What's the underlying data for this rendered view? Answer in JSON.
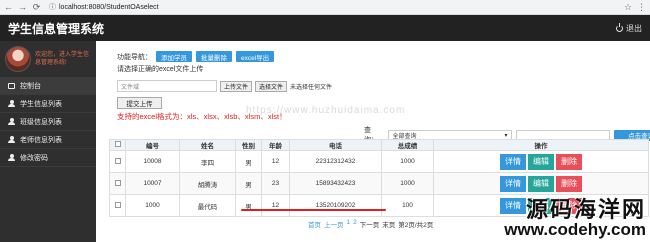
{
  "browser": {
    "url": "localhost:8080/StudentOAselect"
  },
  "header": {
    "title": "学生信息管理系统",
    "logout_label": "退出"
  },
  "sidebar": {
    "welcome": "欢迎您，进入学生信息管理系统!",
    "items": [
      {
        "label": "控制台",
        "icon": "monitor-icon"
      },
      {
        "label": "学生信息列表",
        "icon": "user-icon"
      },
      {
        "label": "班级信息列表",
        "icon": "user-icon"
      },
      {
        "label": "老师信息列表",
        "icon": "user-icon"
      },
      {
        "label": "修改密码",
        "icon": "user-icon"
      }
    ]
  },
  "toolbar": {
    "nav_label": "功能导航：",
    "add_student": "添加学员",
    "batch_delete": "批量删除",
    "excel_export": "excel导出"
  },
  "upload": {
    "hint": "请选择正确的excel文件上传",
    "file_placeholder": "文件域",
    "upload_file_btn": "上传文件",
    "choose_file_btn": "选择文件",
    "no_file": "未选择任何文件",
    "submit_upload": "提交上传",
    "format_hint": "支持的excel格式为：xls、xlsx、xlsb、xlsm、xlst！"
  },
  "watermark_mid": "https://www.huzhuidaima.com",
  "search": {
    "label": "查询：",
    "select_value": "全部查询",
    "button": "点击查询"
  },
  "table": {
    "headers": [
      "编号",
      "姓名",
      "性别",
      "年龄",
      "电话",
      "总成绩",
      "操作"
    ],
    "rows": [
      {
        "id": "10008",
        "name": "李四",
        "gender": "男",
        "age": "12",
        "phone": "22312312432",
        "score": "1000"
      },
      {
        "id": "10007",
        "name": "胡腾涛",
        "gender": "男",
        "age": "23",
        "phone": "15893432423",
        "score": "1000"
      },
      {
        "id": "1000",
        "name": "最代码",
        "gender": "男",
        "age": "12",
        "phone": "13520109202",
        "score": "100"
      }
    ],
    "op_detail": "详情",
    "op_edit": "编辑",
    "op_delete": "删除"
  },
  "pager": {
    "first": "首页",
    "prev": "上一页",
    "p1": "1",
    "p2": "2",
    "next": "下一页",
    "last": "末页",
    "status": "第2页/共2页"
  },
  "watermark": {
    "cn": "源码海洋网",
    "url": "www.codehy.com"
  }
}
